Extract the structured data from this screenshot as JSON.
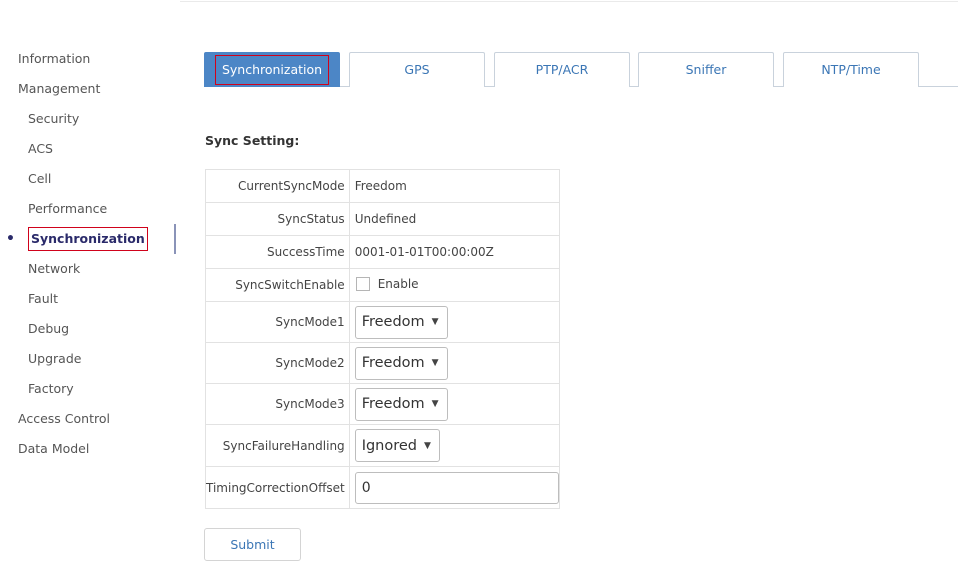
{
  "sidebar": {
    "items": [
      {
        "label": "Information",
        "level": 0
      },
      {
        "label": "Management",
        "level": 0
      },
      {
        "label": "Security",
        "level": 1
      },
      {
        "label": "ACS",
        "level": 1
      },
      {
        "label": "Cell",
        "level": 1
      },
      {
        "label": "Performance",
        "level": 1
      },
      {
        "label": "Synchronization",
        "level": 1,
        "active": true
      },
      {
        "label": "Network",
        "level": 1
      },
      {
        "label": "Fault",
        "level": 1
      },
      {
        "label": "Debug",
        "level": 1
      },
      {
        "label": "Upgrade",
        "level": 1
      },
      {
        "label": "Factory",
        "level": 1
      },
      {
        "label": "Access Control",
        "level": 0
      },
      {
        "label": "Data Model",
        "level": 0
      }
    ],
    "active_bullet": "•"
  },
  "tabs": [
    {
      "label": "Synchronization",
      "active": true
    },
    {
      "label": "GPS"
    },
    {
      "label": "PTP/ACR"
    },
    {
      "label": "Sniffer"
    },
    {
      "label": "NTP/Time"
    }
  ],
  "section_title": "Sync Setting:",
  "form": {
    "current_sync_mode": {
      "label": "CurrentSyncMode",
      "value": "Freedom"
    },
    "sync_status": {
      "label": "SyncStatus",
      "value": "Undefined"
    },
    "success_time": {
      "label": "SuccessTime",
      "value": "0001-01-01T00:00:00Z"
    },
    "sync_switch_enable": {
      "label": "SyncSwitchEnable",
      "checkbox_label": "Enable",
      "checked": false
    },
    "sync_mode1": {
      "label": "SyncMode1",
      "value": "Freedom"
    },
    "sync_mode2": {
      "label": "SyncMode2",
      "value": "Freedom"
    },
    "sync_mode3": {
      "label": "SyncMode3",
      "value": "Freedom"
    },
    "sync_failure_handling": {
      "label": "SyncFailureHandling",
      "value": "Ignored"
    },
    "timing_correction_offset": {
      "label": "TimingCorrectionOffset",
      "value": "0"
    }
  },
  "submit_label": "Submit",
  "icons": {
    "caret": "caret-down-icon",
    "caret_glyph": "▼"
  },
  "colors": {
    "tab_active_bg": "#4c86c6",
    "link": "#3b76b5",
    "highlight_box": "#d0021b"
  }
}
